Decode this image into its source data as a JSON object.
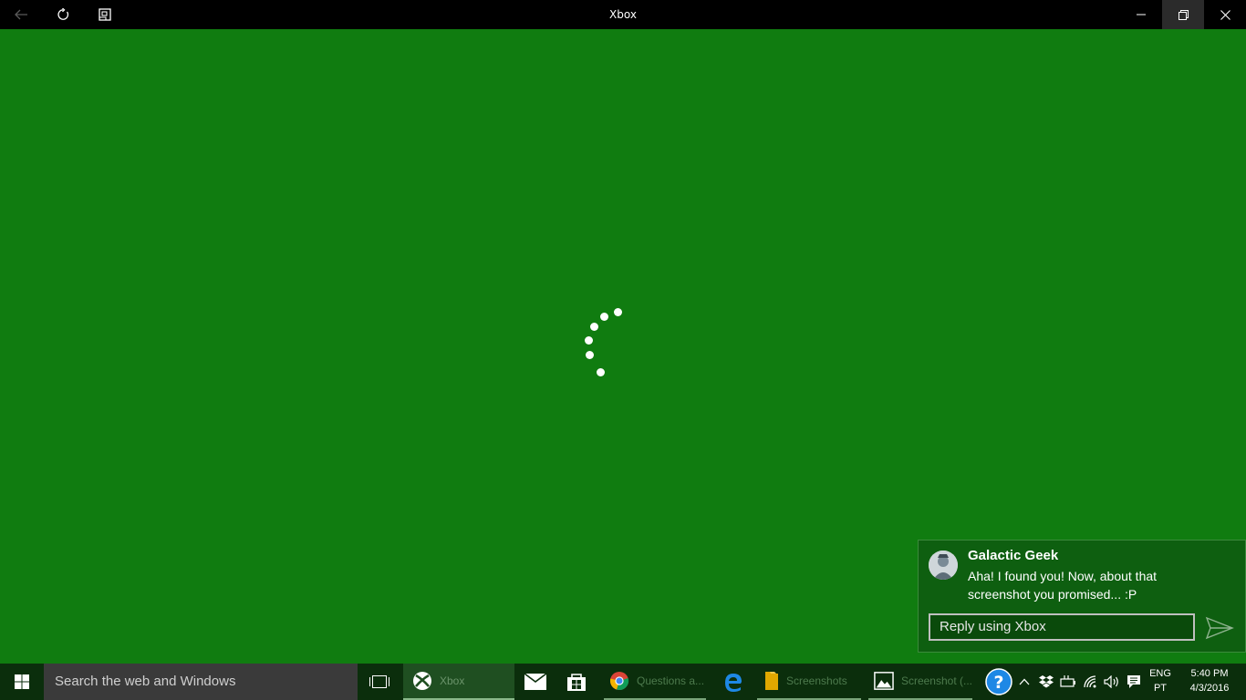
{
  "window": {
    "title": "Xbox",
    "background": "#107c10"
  },
  "titlebar": {
    "back_icon": "back-arrow-icon",
    "refresh_icon": "refresh-icon",
    "gamebar_icon": "game-bar-icon",
    "minimize_icon": "minimize-icon",
    "restore_icon": "restore-icon",
    "close_icon": "close-icon"
  },
  "loading": {
    "icon": "loading-spinner-icon"
  },
  "notification": {
    "sender": "Galactic Geek",
    "message": "Aha! I found you! Now, about that screenshot you promised... :P",
    "reply_placeholder": "Reply using Xbox",
    "send_icon": "send-icon"
  },
  "taskbar": {
    "search_placeholder": "Search the web and Windows",
    "apps": [
      {
        "label": "Xbox",
        "icon": "xbox-icon"
      },
      {
        "label": "",
        "icon": "mail-icon"
      },
      {
        "label": "",
        "icon": "store-icon"
      },
      {
        "label": "Questions a...",
        "icon": "chrome-icon"
      },
      {
        "label": "",
        "icon": "edge-icon"
      },
      {
        "label": "Screenshots",
        "icon": "folder-icon"
      },
      {
        "label": "Screenshot (...",
        "icon": "photos-icon"
      }
    ],
    "tray": {
      "lang_line1": "ENG",
      "lang_line2": "PT",
      "time": "5:40 PM",
      "date": "4/3/2016"
    }
  }
}
